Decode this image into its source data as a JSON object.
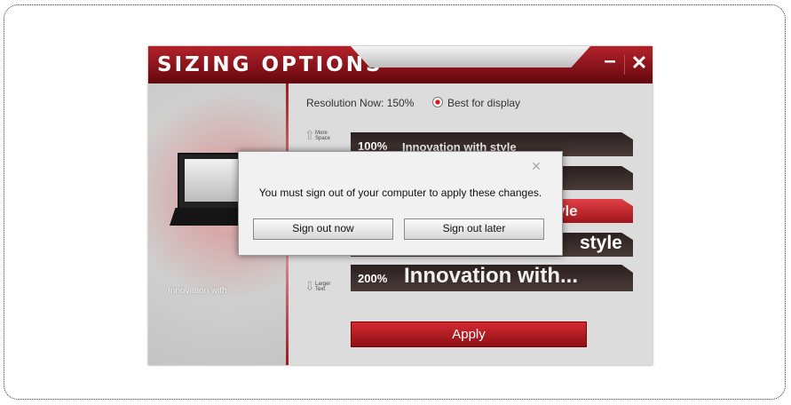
{
  "window": {
    "title": "SIZING OPTIONS",
    "minimize_glyph": "–",
    "close_glyph": "✕"
  },
  "sidebar": {
    "promo_label": "Innovation with",
    "logo_text": "msi"
  },
  "resolution": {
    "current_label": "Resolution Now: 150%",
    "option_label": "Best for display",
    "option_selected": true
  },
  "hints": {
    "top": [
      "More",
      "Space"
    ],
    "bottom": [
      "Larger",
      "Text"
    ]
  },
  "size_options": [
    {
      "percent": "100%",
      "sample_text": "Innovation with style",
      "selected": false
    },
    {
      "percent": "",
      "sample_text": "",
      "selected": false
    },
    {
      "percent": "",
      "sample_text": "yle",
      "selected": true
    },
    {
      "percent": "",
      "sample_text": "style",
      "selected": false
    },
    {
      "percent": "200%",
      "sample_text": "Innovation with...",
      "selected": false
    }
  ],
  "apply_label": "Apply",
  "dialog": {
    "close_glyph": "✕",
    "message": "You must sign out of your computer to apply these changes.",
    "sign_out_now_label": "Sign out now",
    "sign_out_later_label": "Sign out later"
  },
  "colors": {
    "brand_red": "#b3222b",
    "dark_option": "#2a2120",
    "accent": "#e14147"
  }
}
